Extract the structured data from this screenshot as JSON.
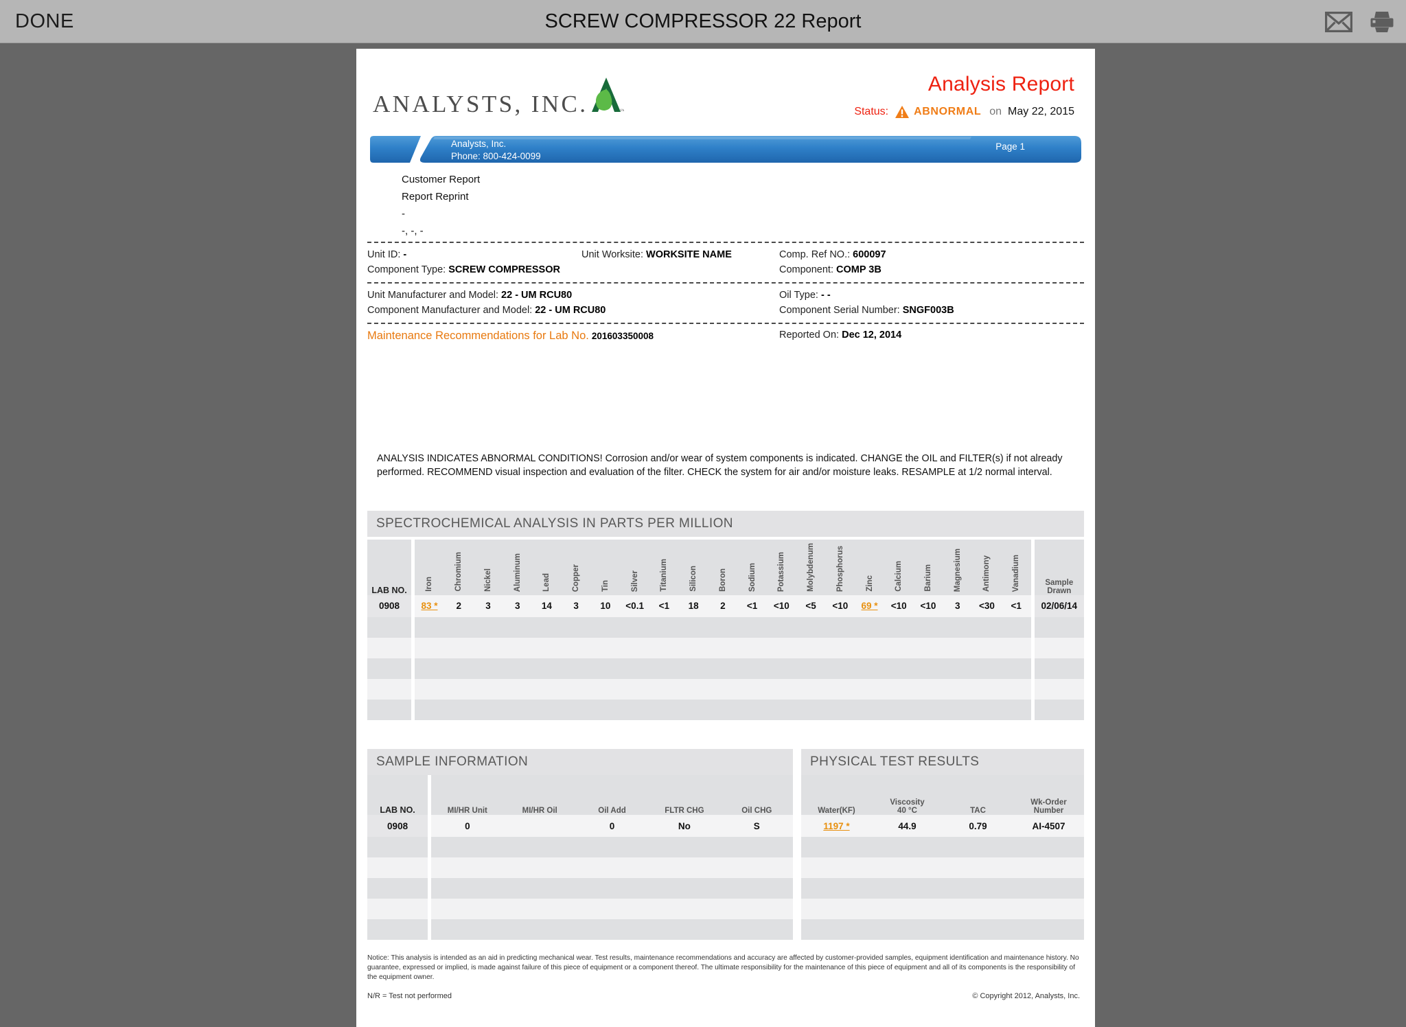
{
  "topbar": {
    "done_label": "DONE",
    "title": "SCREW COMPRESSOR 22 Report",
    "mail_icon": "mail-icon",
    "print_icon": "print-icon"
  },
  "report": {
    "logo_text": "ANALYSTS, INC.",
    "logo_tm": "™",
    "title": "Analysis Report",
    "status_label": "Status:",
    "status_value": "ABNORMAL",
    "status_on": "on",
    "status_date": "May 22, 2015",
    "warning_icon": "warning-triangle-icon"
  },
  "banner": {
    "company": "Analysts, Inc.",
    "phone": "Phone: 800-424-0099",
    "page": "Page 1"
  },
  "customer": {
    "line1": "Customer Report",
    "line2": "Report Reprint",
    "line3": "-",
    "line4": "-, -, -"
  },
  "info": {
    "unit_id_label": "Unit ID:",
    "unit_id_value": "-",
    "unit_worksite_label": "Unit Worksite:",
    "unit_worksite_value": "WORKSITE NAME",
    "comp_ref_label": "Comp. Ref NO.:",
    "comp_ref_value": "600097",
    "component_type_label": "Component Type:",
    "component_type_value": "SCREW COMPRESSOR",
    "component_label": "Component:",
    "component_value": "COMP 3B",
    "unit_mfr_label": "Unit Manufacturer and Model:",
    "unit_mfr_value": "22 - UM RCU80",
    "oil_type_label": "Oil Type:",
    "oil_type_value": "- -",
    "comp_mfr_label": "Component Manufacturer and Model:",
    "comp_mfr_value": "22 - UM RCU80",
    "comp_serial_label": "Component Serial Number:",
    "comp_serial_value": "SNGF003B",
    "maint_label": "Maintenance Recommendations for Lab No.",
    "maint_value": "201603350008",
    "reported_on_label": "Reported On:",
    "reported_on_value": "Dec 12, 2014"
  },
  "recommendation": "ANALYSIS INDICATES ABNORMAL CONDITIONS!   Corrosion and/or wear of system components is indicated.  CHANGE the OIL and FILTER(s) if not already performed.  RECOMMEND visual inspection and evaluation of the filter.  CHECK the system for air and/or moisture leaks.  RESAMPLE at 1/2 normal interval.",
  "spectro": {
    "section_title": "SPECTROCHEMICAL ANALYSIS IN PARTS PER MILLION",
    "lab_no_header": "LAB NO.",
    "sample_drawn_header_l1": "Sample",
    "sample_drawn_header_l2": "Drawn",
    "elements": [
      "Iron",
      "Chromium",
      "Nickel",
      "Aluminum",
      "Lead",
      "Copper",
      "Tin",
      "Silver",
      "Titanium",
      "Silicon",
      "Boron",
      "Sodium",
      "Potassium",
      "Molybdenum",
      "Phosphorus",
      "Zinc",
      "Calcium",
      "Barium",
      "Magnesium",
      "Antimony",
      "Vanadium"
    ],
    "rows": [
      {
        "lab_no": "0908",
        "values": [
          "83 *",
          "2",
          "3",
          "3",
          "14",
          "3",
          "10",
          "<0.1",
          "<1",
          "18",
          "2",
          "<1",
          "<10",
          "<5",
          "<10",
          "69 *",
          "<10",
          "<10",
          "3",
          "<30",
          "<1"
        ],
        "flagged": [
          0,
          15
        ],
        "sample_drawn": "02/06/14"
      }
    ],
    "empty_rows": 5
  },
  "sample_info": {
    "section_title": "SAMPLE INFORMATION",
    "columns": [
      "LAB NO.",
      "MI/HR Unit",
      "MI/HR Oil",
      "Oil Add",
      "FLTR CHG",
      "Oil CHG"
    ],
    "rows": [
      {
        "values": [
          "0908",
          "0",
          "",
          "0",
          "No",
          "S"
        ]
      }
    ],
    "empty_rows": 5
  },
  "physical": {
    "section_title": "PHYSICAL TEST RESULTS",
    "columns": [
      {
        "l1": "Water(KF)",
        "l2": ""
      },
      {
        "l1": "Viscosity",
        "l2": "40 °C"
      },
      {
        "l1": "TAC",
        "l2": ""
      },
      {
        "l1": "Wk-Order",
        "l2": "Number"
      }
    ],
    "rows": [
      {
        "values": [
          "1197 *",
          "44.9",
          "0.79",
          "AI-4507"
        ],
        "flagged": [
          0
        ]
      }
    ],
    "empty_rows": 5
  },
  "footer": {
    "notice": "Notice: This analysis is intended as an aid in predicting mechanical wear. Test results, maintenance recommendations and accuracy are affected by customer-provided samples, equipment identification and maintenance history.  No guarantee, expressed or implied, is made against failure of this piece of equipment or a component thereof. The ultimate responsibility for the maintenance of this piece of equipment and all of its components is the responsibility of the equipment owner.",
    "nr_note": "N/R = Test not performed",
    "copyright": "© Copyright 2012, Analysts, Inc."
  },
  "colors": {
    "accent_red": "#ee2211",
    "accent_orange": "#f07d17",
    "banner_blue": "#2f80c8",
    "logo_green_dark": "#186b3a",
    "logo_green_light": "#5cba47",
    "chrome_gray": "#b6b6b6",
    "page_bg": "#666666"
  }
}
